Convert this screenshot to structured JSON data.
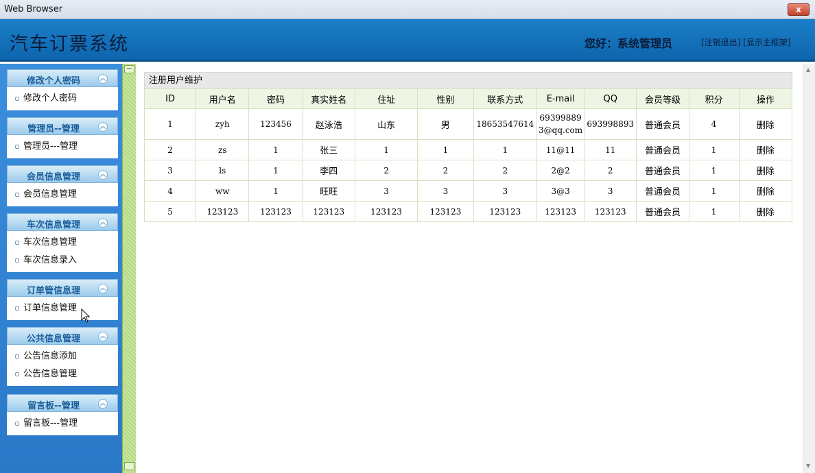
{
  "window": {
    "title": "Web Browser",
    "close_label": "x"
  },
  "header": {
    "app_title": "汽车订票系统",
    "greeting": "您好：系统管理员",
    "logout_link": "[注销退出]",
    "show_frame_link": "[显示主框架]"
  },
  "sidebar": {
    "groups": [
      {
        "title": "修改个人密码",
        "items": [
          "修改个人密码"
        ]
      },
      {
        "title": "管理员--管理",
        "items": [
          "管理员---管理"
        ]
      },
      {
        "title": "会员信息管理",
        "items": [
          "会员信息管理"
        ]
      },
      {
        "title": "车次信息管理",
        "items": [
          "车次信息管理",
          "车次信息录入"
        ]
      },
      {
        "title": "订单管信息理",
        "items": [
          "订单信息管理"
        ]
      },
      {
        "title": "公共信息管理",
        "items": [
          "公告信息添加",
          "公告信息管理"
        ]
      },
      {
        "title": "留言板--管理",
        "items": [
          "留言板---管理"
        ]
      }
    ]
  },
  "panel": {
    "title": "注册用户维护",
    "columns": [
      "ID",
      "用户名",
      "密码",
      "真实姓名",
      "住址",
      "性别",
      "联系方式",
      "E-mail",
      "QQ",
      "会员等级",
      "积分",
      "操作"
    ],
    "rows": [
      [
        "1",
        "zyh",
        "123456",
        "赵泳浩",
        "山东",
        "男",
        "18653547614",
        "693998893@qq.com",
        "693998893",
        "普通会员",
        "4",
        "删除"
      ],
      [
        "2",
        "zs",
        "1",
        "张三",
        "1",
        "1",
        "1",
        "11@11",
        "11",
        "普通会员",
        "1",
        "删除"
      ],
      [
        "3",
        "ls",
        "1",
        "李四",
        "2",
        "2",
        "2",
        "2@2",
        "2",
        "普通会员",
        "1",
        "删除"
      ],
      [
        "4",
        "ww",
        "1",
        "旺旺",
        "3",
        "3",
        "3",
        "3@3",
        "3",
        "普通会员",
        "1",
        "删除"
      ],
      [
        "5",
        "123123",
        "123123",
        "123123",
        "123123",
        "123123",
        "123123",
        "123123",
        "123123",
        "普通会员",
        "1",
        "删除"
      ]
    ]
  },
  "icons": {
    "group_collapse": "chevron-up-icon",
    "item_bullet": "square-bullet-icon",
    "cursor": "mouse-pointer-icon"
  },
  "colors": {
    "header_blue": "#1a7fc8",
    "sidebar_blue": "#3b8fdc",
    "table_header_bg": "#eef5e4",
    "splitter_green": "#c9e7a0"
  }
}
